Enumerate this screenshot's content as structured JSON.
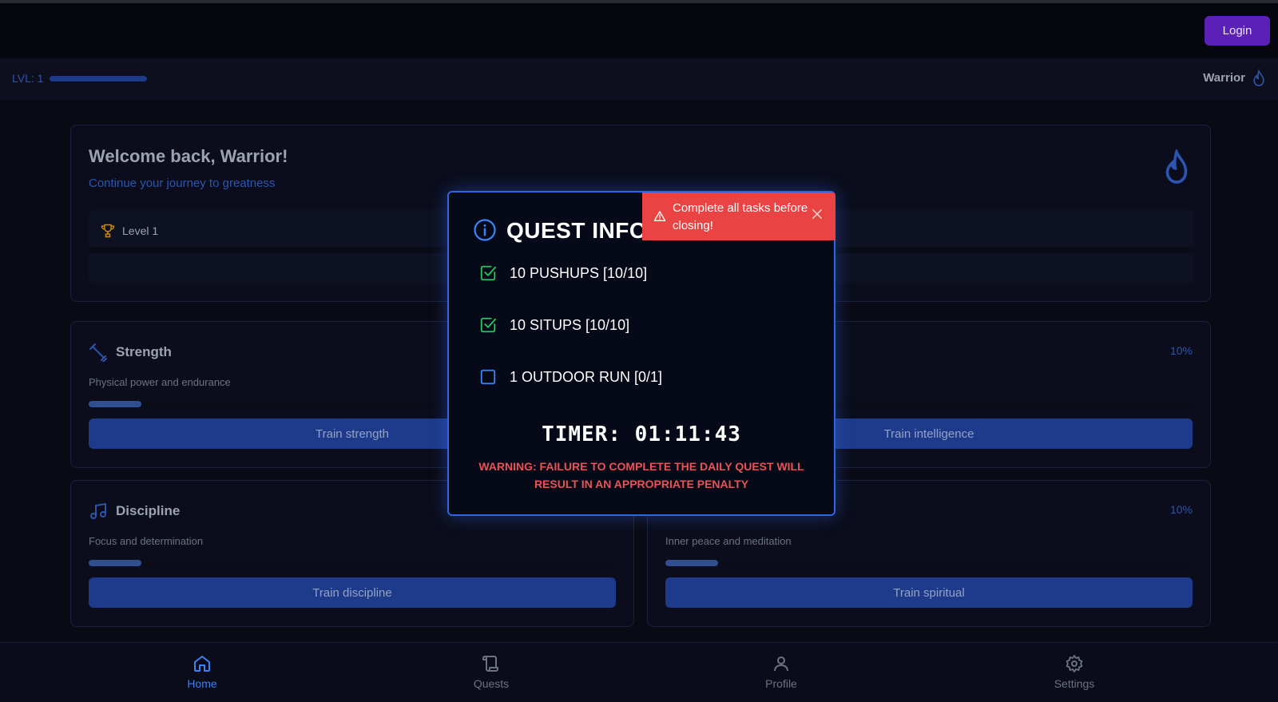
{
  "header": {
    "login_label": "Login"
  },
  "status": {
    "level_label": "LVL: 1",
    "xp_progress_percent": 100,
    "rank": "Warrior"
  },
  "welcome": {
    "title": "Welcome back, Warrior!",
    "subtitle": "Continue your journey to greatness",
    "level_label": "Level 1"
  },
  "stats": {
    "strength": {
      "title": "Strength",
      "desc": "Physical power and endurance",
      "button": "Train strength",
      "progress_percent": 10
    },
    "intelligence": {
      "pct": "10%",
      "button": "Train intelligence",
      "progress_percent": 10
    },
    "discipline": {
      "title": "Discipline",
      "desc": "Focus and determination",
      "button": "Train discipline",
      "progress_percent": 10
    },
    "spiritual": {
      "pct": "10%",
      "desc": "Inner peace and meditation",
      "button": "Train spiritual",
      "progress_percent": 10
    }
  },
  "modal": {
    "title": "QUEST INFO",
    "tasks": [
      {
        "label": "10 PUSHUPS [10/10]",
        "done": true
      },
      {
        "label": "10 SITUPS [10/10]",
        "done": true
      },
      {
        "label": "1 OUTDOOR RUN [0/1]",
        "done": false
      }
    ],
    "timer": "TIMER: 01:11:43",
    "warning": "WARNING: FAILURE TO COMPLETE THE DAILY QUEST WILL RESULT IN AN APPROPRIATE PENALTY"
  },
  "toast": {
    "message": "Complete all tasks before closing!"
  },
  "nav": {
    "home": "Home",
    "quests": "Quests",
    "profile": "Profile",
    "settings": "Settings"
  },
  "colors": {
    "accent": "#1e3a8a",
    "modal_border": "#2e66e0",
    "toast": "#e94343",
    "check": "#22c55e",
    "login": "#5b21b6"
  }
}
